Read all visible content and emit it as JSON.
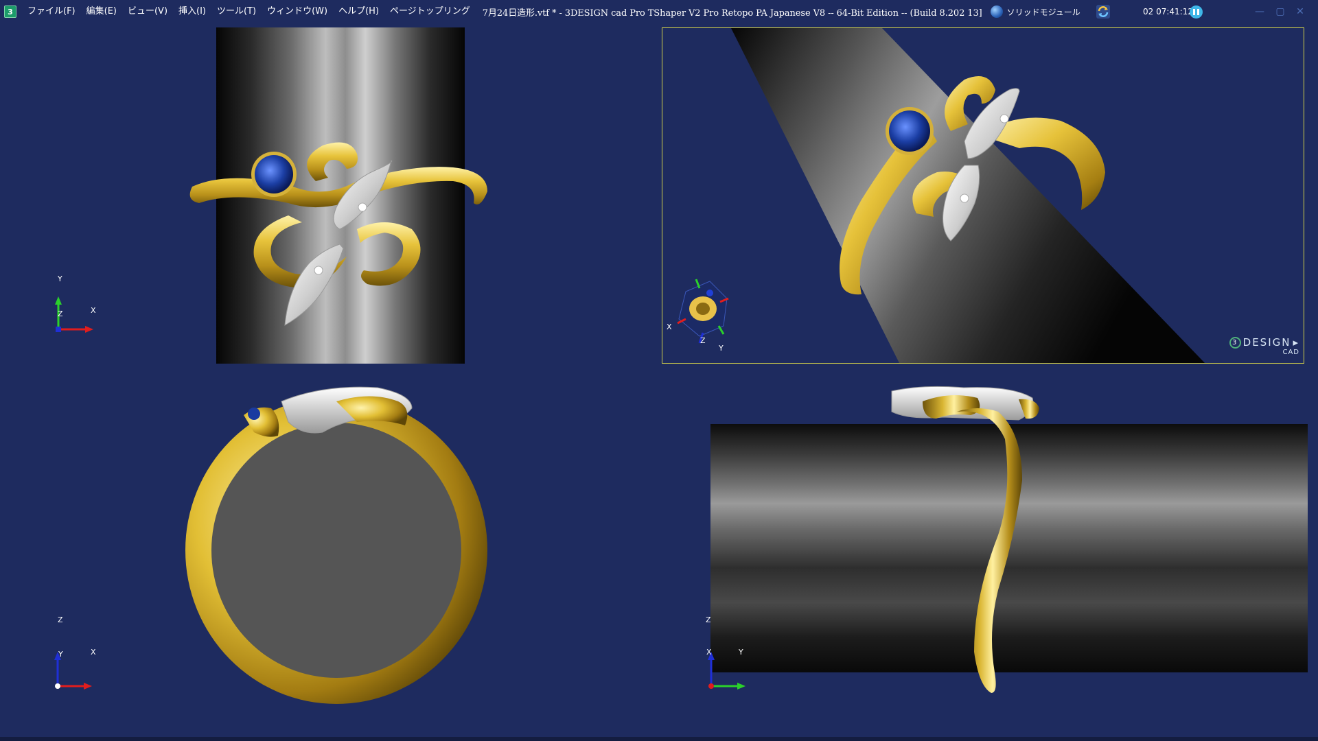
{
  "titlebar": {
    "app_icon_letter": "3",
    "menu": [
      "ファイル(F)",
      "編集(E)",
      "ビュー(V)",
      "挿入(I)",
      "ツール(T)",
      "ウィンドウ(W)",
      "ヘルプ(H)",
      "ページトップリング"
    ],
    "document_title": "7月24日造形.vtf * -  3DESIGN cad Pro TShaper V2 Pro Retopo PA  Japanese V8 -- 64-Bit Edition --   (Build 8.202 13]",
    "module_label": "ソリッドモジュール",
    "clock": "02 07:41:12",
    "window_controls": [
      "—",
      "▢",
      "✕"
    ]
  },
  "viewports": {
    "top_left": {
      "axes": [
        "Y",
        "Z",
        "X"
      ]
    },
    "top_right": {
      "axes": [
        "X",
        "Z",
        "Y"
      ],
      "brand_main": "DESIGN",
      "brand_circle": "3",
      "brand_sub": "CAD"
    },
    "bottom_left": {
      "axes": [
        "Z",
        "Y",
        "X"
      ]
    },
    "bottom_right": {
      "axes": [
        "Z",
        "X",
        "Y"
      ]
    }
  },
  "colors": {
    "background": "#1e2b5f",
    "gold": "#e2c13a",
    "silver": "#e4e4e4",
    "sapphire": "#1d3fa8",
    "active_border": "#d4d24a"
  }
}
